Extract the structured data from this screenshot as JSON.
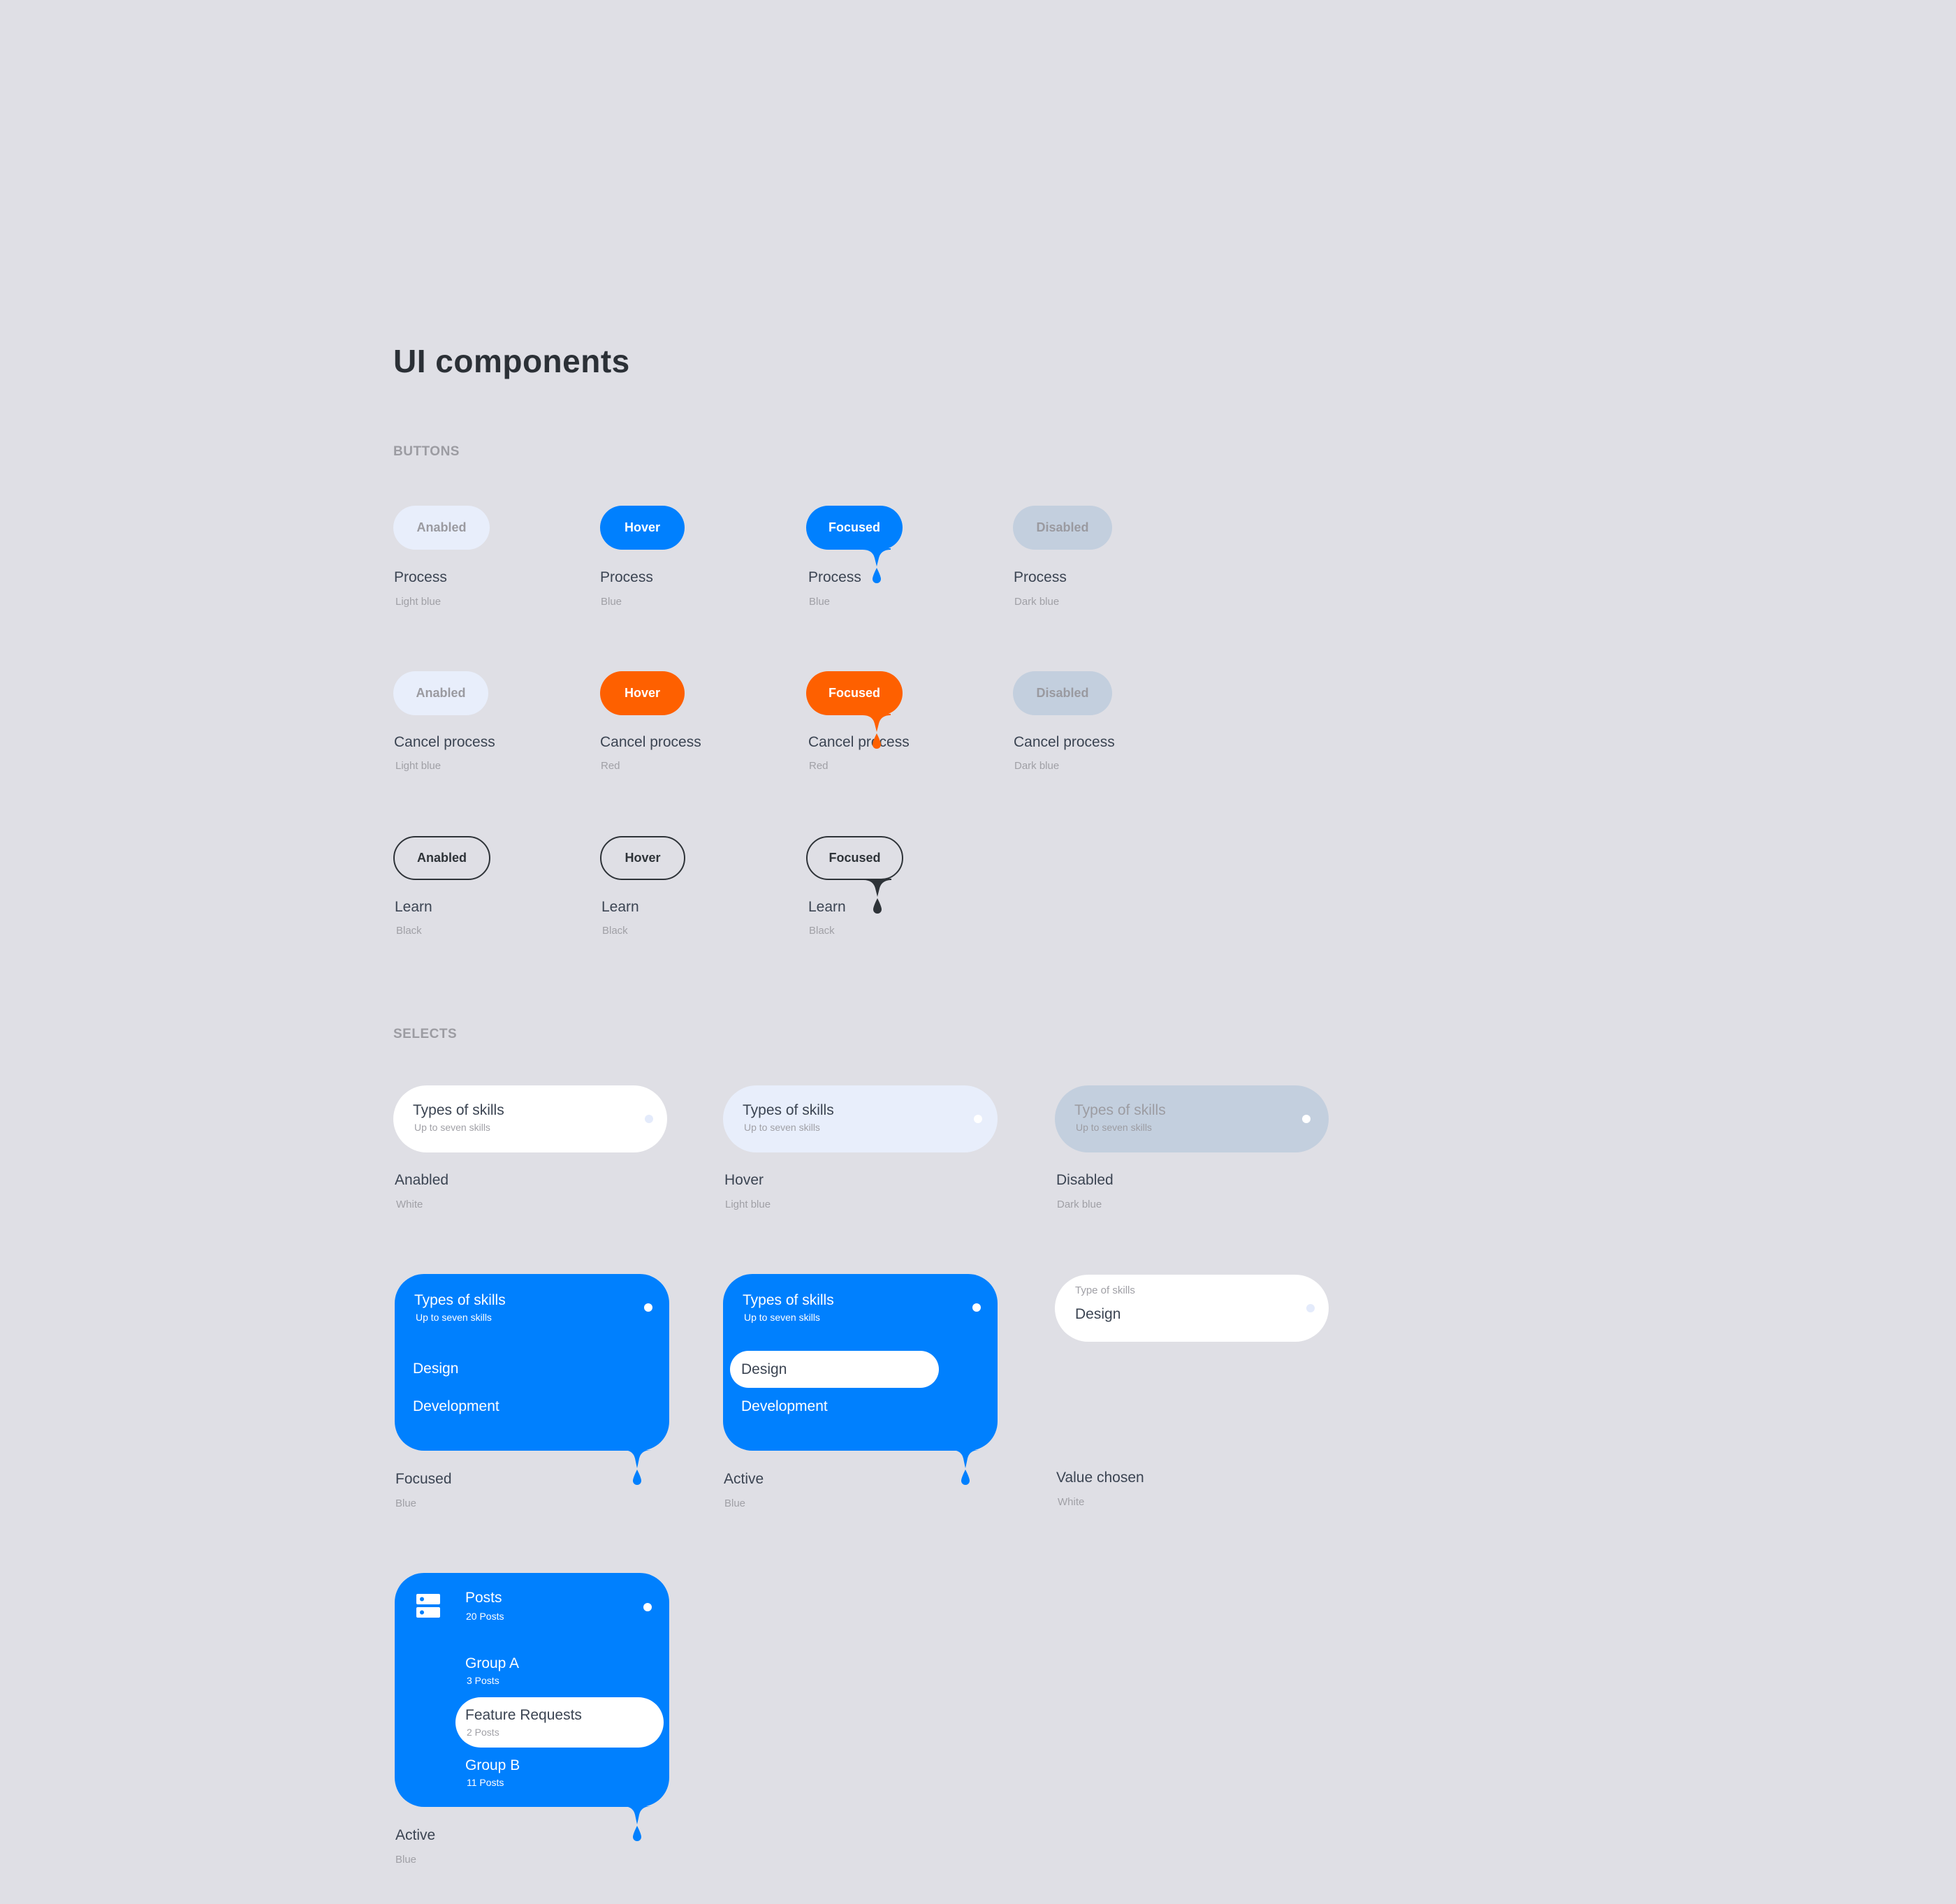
{
  "page": {
    "title": "UI components"
  },
  "colors": {
    "blue": "#0080fe",
    "red": "#fe6000",
    "light_blue": "#e8eefb",
    "dark_blue": "#c3cfde",
    "black": "#2e3338",
    "background": "#dfdfe5"
  },
  "buttons_section": {
    "heading": "BUTTONS",
    "rows": [
      {
        "name": "Process",
        "items": [
          {
            "state": "Anabled",
            "label": "Process",
            "color": "Light blue"
          },
          {
            "state": "Hover",
            "label": "Process",
            "color": "Blue"
          },
          {
            "state": "Focused",
            "label": "Process",
            "color": "Blue"
          },
          {
            "state": "Disabled",
            "label": "Process",
            "color": "Dark blue"
          }
        ]
      },
      {
        "name": "Cancel process",
        "items": [
          {
            "state": "Anabled",
            "label": "Cancel process",
            "color": "Light blue"
          },
          {
            "state": "Hover",
            "label": "Cancel process",
            "color": "Red"
          },
          {
            "state": "Focused",
            "label": "Cancel process",
            "color": "Red"
          },
          {
            "state": "Disabled",
            "label": "Cancel process",
            "color": "Dark blue"
          }
        ]
      },
      {
        "name": "Learn",
        "items": [
          {
            "state": "Anabled",
            "label": "Learn",
            "color": "Black"
          },
          {
            "state": "Hover",
            "label": "Learn",
            "color": "Black"
          },
          {
            "state": "Focused",
            "label": "Learn",
            "color": "Black"
          }
        ]
      }
    ]
  },
  "selects_section": {
    "heading": "SELECTS",
    "enabled": {
      "title": "Types of skills",
      "subtitle": "Up to seven skills",
      "label": "Anabled",
      "color": "White"
    },
    "hover": {
      "title": "Types of skills",
      "subtitle": "Up to seven skills",
      "label": "Hover",
      "color": "Light blue"
    },
    "disabled": {
      "title": "Types of skills",
      "subtitle": "Up to seven skills",
      "label": "Disabled",
      "color": "Dark blue"
    },
    "focused": {
      "title": "Types of skills",
      "subtitle": "Up to seven skills",
      "options": [
        "Design",
        "Development"
      ],
      "label": "Focused",
      "color": "Blue"
    },
    "active": {
      "title": "Types of skills",
      "subtitle": "Up to seven skills",
      "options": [
        "Design",
        "Development"
      ],
      "selected": "Design",
      "label": "Active",
      "color": "Blue"
    },
    "value_chosen": {
      "field_label": "Type of skills",
      "value": "Design",
      "label": "Value chosen",
      "color": "White"
    },
    "posts": {
      "icon": "server-icon",
      "title": "Posts",
      "subtitle": "20 Posts",
      "items": [
        {
          "title": "Group A",
          "count": "3 Posts"
        },
        {
          "title": "Feature Requests",
          "count": "2 Posts",
          "selected": true
        },
        {
          "title": "Group B",
          "count": "11 Posts"
        }
      ],
      "label": "Active",
      "color": "Blue"
    }
  }
}
